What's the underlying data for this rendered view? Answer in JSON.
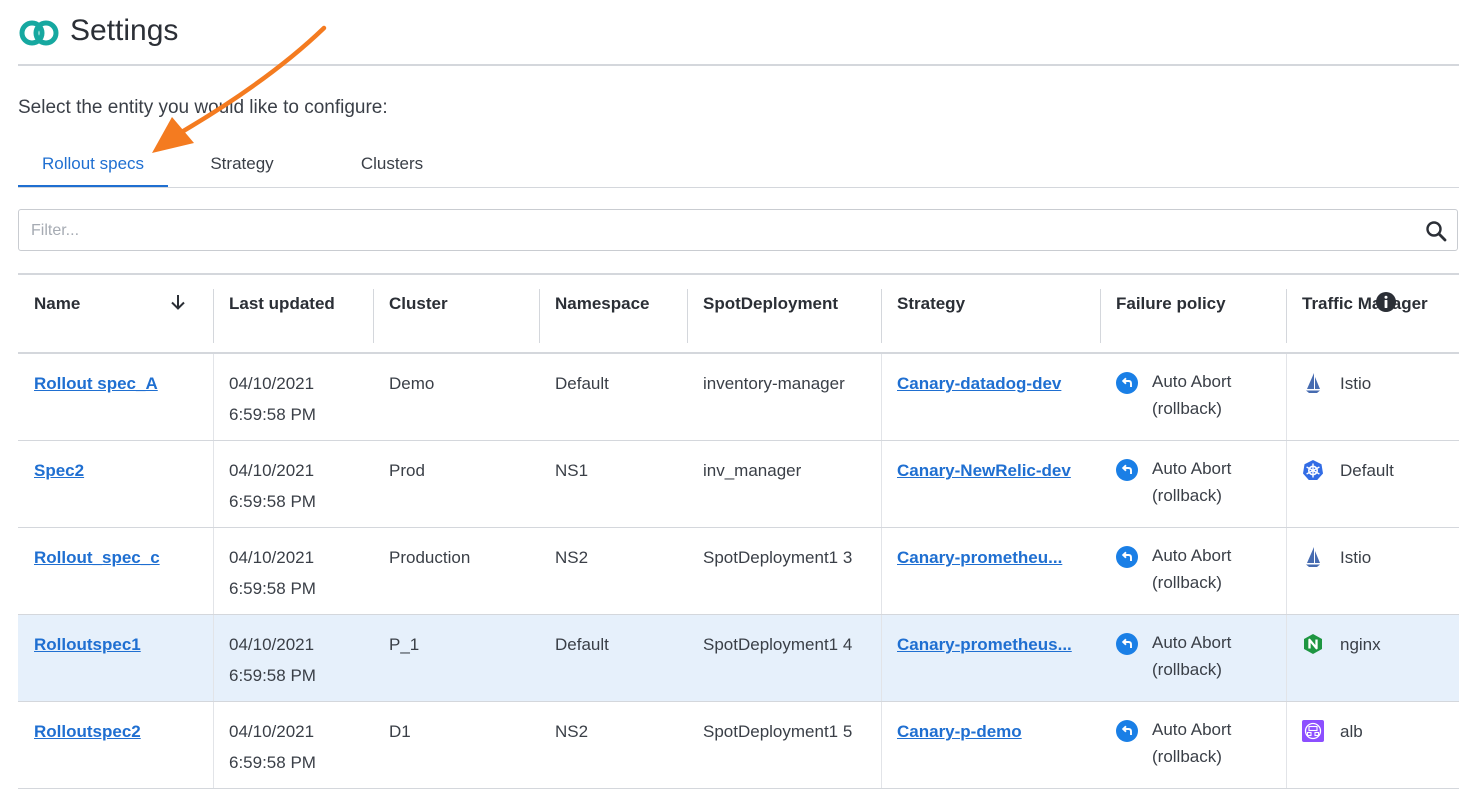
{
  "header": {
    "title": "Settings"
  },
  "prompt": "Select the entity you would like to configure:",
  "tabs": [
    {
      "label": "Rollout specs",
      "active": true
    },
    {
      "label": "Strategy",
      "active": false
    },
    {
      "label": "Clusters",
      "active": false
    }
  ],
  "filter": {
    "placeholder": "Filter...",
    "value": ""
  },
  "table": {
    "columns": [
      "Name",
      "Last updated",
      "Cluster",
      "Namespace",
      "SpotDeployment",
      "Strategy",
      "Failure policy",
      "Traffic Manager"
    ],
    "sort": {
      "column": "Name",
      "direction": "descending"
    },
    "rows": [
      {
        "name": "Rollout spec_A",
        "date": "04/10/2021",
        "time": "6:59:58 PM",
        "cluster": "Demo",
        "namespace": "Default",
        "spot": "inventory-manager",
        "strategy": "Canary-datadog-dev",
        "policy_line1": "Auto Abort",
        "policy_line2": "(rollback)",
        "traffic": "Istio",
        "traffic_icon": "istio-icon",
        "selected": false
      },
      {
        "name": "Spec2",
        "date": "04/10/2021",
        "time": "6:59:58 PM",
        "cluster": "Prod",
        "namespace": "NS1",
        "spot": "inv_manager",
        "strategy": "Canary-NewRelic-dev",
        "policy_line1": "Auto Abort",
        "policy_line2": "(rollback)",
        "traffic": "Default",
        "traffic_icon": "kubernetes-icon",
        "selected": false
      },
      {
        "name": "Rollout_spec_c",
        "date": "04/10/2021",
        "time": "6:59:58 PM",
        "cluster": "Production",
        "namespace": "NS2",
        "spot": "SpotDeployment1 3",
        "strategy": "Canary-prometheu...",
        "policy_line1": "Auto Abort",
        "policy_line2": "(rollback)",
        "traffic": "Istio",
        "traffic_icon": "istio-icon",
        "selected": false
      },
      {
        "name": "Rolloutspec1",
        "date": "04/10/2021",
        "time": "6:59:58 PM",
        "cluster": "P_1",
        "namespace": "Default",
        "spot": "SpotDeployment1 4",
        "strategy": "Canary-prometheus...",
        "policy_line1": "Auto Abort",
        "policy_line2": "(rollback)",
        "traffic": "nginx",
        "traffic_icon": "nginx-icon",
        "selected": true
      },
      {
        "name": "Rolloutspec2",
        "date": "04/10/2021",
        "time": "6:59:58 PM",
        "cluster": "D1",
        "namespace": "NS2",
        "spot": "SpotDeployment1 5",
        "strategy": "Canary-p-demo",
        "policy_line1": "Auto Abort",
        "policy_line2": "(rollback)",
        "traffic": "alb",
        "traffic_icon": "alb-icon",
        "selected": false
      }
    ]
  },
  "colors": {
    "accent": "#1f6fd1",
    "selected_row": "#e6f0fb",
    "annotation_arrow": "#f47b20",
    "logo": "#16a8a0"
  }
}
